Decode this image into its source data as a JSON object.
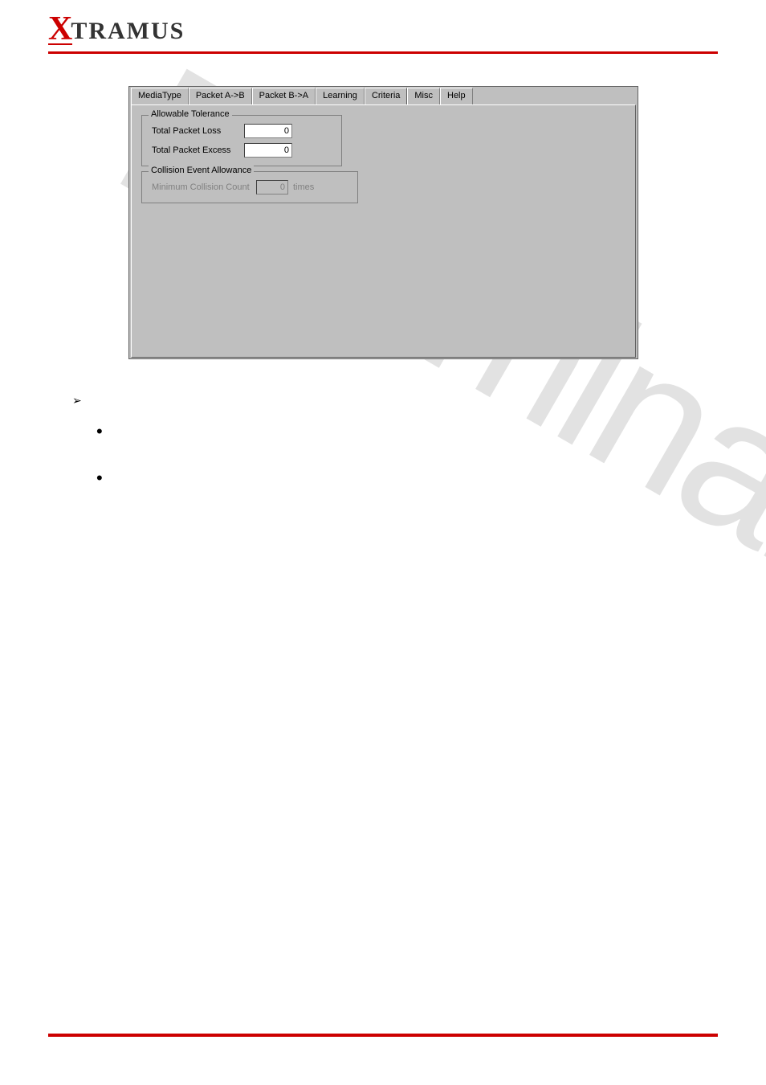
{
  "logo": {
    "x": "X",
    "text": "TRAMUS"
  },
  "watermark": "Preliminary",
  "tabs": {
    "items": [
      {
        "label": "MediaType"
      },
      {
        "label": "Packet A->B"
      },
      {
        "label": "Packet B->A"
      },
      {
        "label": "Learning"
      },
      {
        "label": "Criteria"
      },
      {
        "label": "Misc"
      },
      {
        "label": "Help"
      }
    ],
    "activeIndex": 4
  },
  "groupbox1": {
    "legend": "Allowable Tolerance",
    "row1_label": "Total Packet Loss",
    "row1_value": "0",
    "row2_label": "Total Packet Excess",
    "row2_value": "0"
  },
  "groupbox2": {
    "legend": "Collision Event Allowance",
    "row1_label": "Minimum Collision Count",
    "row1_value": "0",
    "row1_suffix": "times"
  },
  "bullets": {
    "arrow": "➢",
    "dot1": "•",
    "dot2": "•"
  }
}
